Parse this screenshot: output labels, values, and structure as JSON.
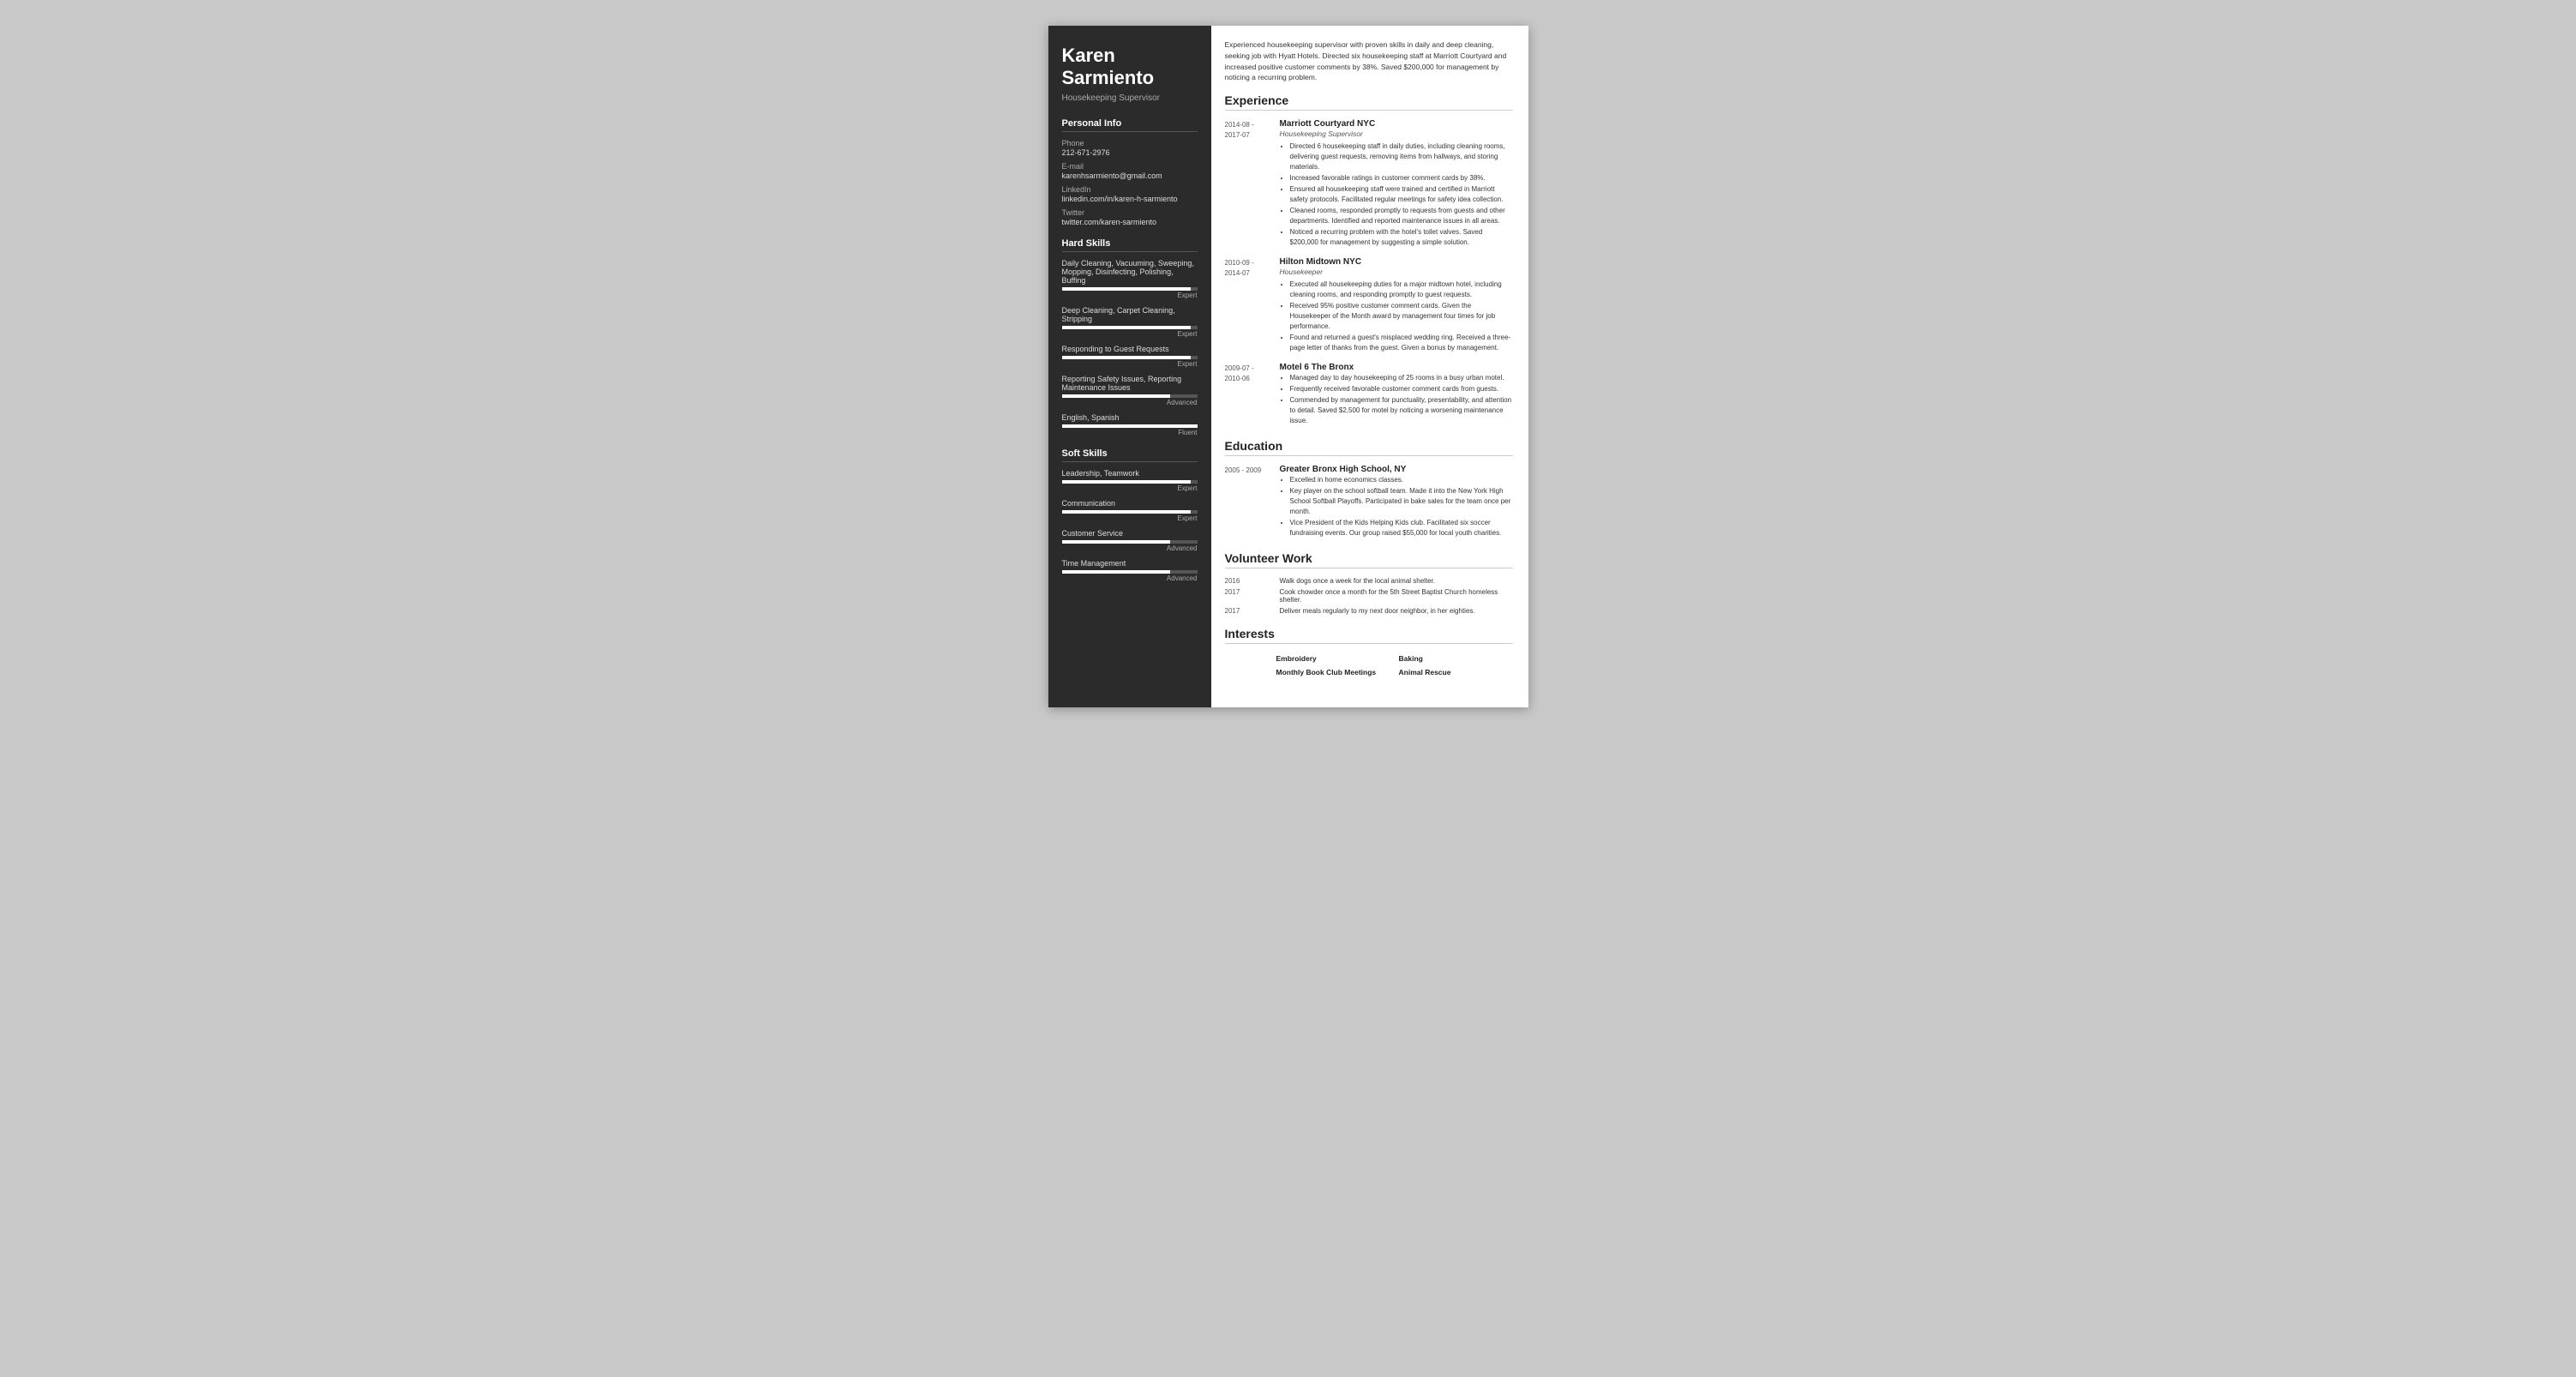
{
  "sidebar": {
    "name_line1": "Karen",
    "name_line2": "Sarmiento",
    "job_title": "Housekeeping Supervisor",
    "personal_info": {
      "section_title": "Personal Info",
      "phone_label": "Phone",
      "phone_value": "212-671-2976",
      "email_label": "E-mail",
      "email_value": "karenhsarmiento@gmail.com",
      "linkedin_label": "LinkedIn",
      "linkedin_value": "linkedin.com/in/karen-h-sarmiento",
      "twitter_label": "Twitter",
      "twitter_value": "twitter.com/karen-sarmiento"
    },
    "hard_skills": {
      "section_title": "Hard Skills",
      "skills": [
        {
          "name": "Daily Cleaning, Vacuuming, Sweeping, Mopping, Disinfecting, Polishing, Buffing",
          "level": "Expert",
          "pct": 95
        },
        {
          "name": "Deep Cleaning, Carpet Cleaning, Stripping",
          "level": "Expert",
          "pct": 95
        },
        {
          "name": "Responding to Guest Requests",
          "level": "Expert",
          "pct": 95
        },
        {
          "name": "Reporting Safety Issues, Reporting Maintenance Issues",
          "level": "Advanced",
          "pct": 80
        },
        {
          "name": "English, Spanish",
          "level": "Fluent",
          "pct": 100
        }
      ]
    },
    "soft_skills": {
      "section_title": "Soft Skills",
      "skills": [
        {
          "name": "Leadership, Teamwork",
          "level": "Expert",
          "pct": 95
        },
        {
          "name": "Communication",
          "level": "Expert",
          "pct": 95
        },
        {
          "name": "Customer Service",
          "level": "Advanced",
          "pct": 80
        },
        {
          "name": "Time Management",
          "level": "Advanced",
          "pct": 80
        }
      ]
    }
  },
  "main": {
    "summary": "Experienced housekeeping supervisor with proven skills in daily and deep cleaning, seeking job with Hyatt Hotels. Directed six housekeeping staff at Marriott Courtyard and increased positive customer comments by 38%. Saved $200,000 for management by noticing a recurring problem.",
    "experience": {
      "section_title": "Experience",
      "entries": [
        {
          "date": "2014-08 - 2017-07",
          "company": "Marriott Courtyard NYC",
          "title": "Housekeeping Supervisor",
          "bullets": [
            "Directed 6 housekeeping staff in daily duties, including cleaning rooms, delivering guest requests, removing items from hallways, and storing materials.",
            "Increased favorable ratings in customer comment cards by 38%.",
            "Ensured all housekeeping staff were trained and certified in Marriott safety protocols. Facilitated regular meetings for safety idea collection.",
            "Cleaned rooms, responded promptly to requests from guests and other departments. Identified and reported maintenance issues in all areas.",
            "Noticed a recurring problem with the hotel's toilet valves. Saved $200,000 for management by suggesting a simple solution."
          ]
        },
        {
          "date": "2010-09 - 2014-07",
          "company": "Hilton Midtown NYC",
          "title": "Housekeeper",
          "bullets": [
            "Executed all housekeeping duties for a major midtown hotel, including cleaning rooms, and responding promptly to guest requests.",
            "Received 95% positive customer comment cards. Given the Housekeeper of the Month award by management four times for job performance.",
            "Found and returned a guest's misplaced wedding ring. Received a three-page letter of thanks from the guest. Given a bonus by management."
          ]
        },
        {
          "date": "2009-07 - 2010-06",
          "company": "Motel 6 The Bronx",
          "title": "",
          "bullets": [
            "Managed day to day housekeeping of 25 rooms in a busy urban motel.",
            "Frequently received favorable customer comment cards from guests.",
            "Commended by management for punctuality, presentability, and attention to detail. Saved $2,500 for motel by noticing a worsening maintenance issue."
          ]
        }
      ]
    },
    "education": {
      "section_title": "Education",
      "entries": [
        {
          "date": "2005 - 2009",
          "school": "Greater Bronx High School, NY",
          "bullets": [
            "Excelled in home economics classes.",
            "Key player on the school softball team. Made it into the New York High School Softball Playoffs. Participated in bake sales for the team once per month.",
            "Vice President of the Kids Helping Kids club. Facilitated six soccer fundraising events. Our group raised $55,000 for local youth charities."
          ]
        }
      ]
    },
    "volunteer": {
      "section_title": "Volunteer Work",
      "entries": [
        {
          "year": "2016",
          "text": "Walk dogs once a week for the local animal shelter."
        },
        {
          "year": "2017",
          "text": "Cook chowder once a month for the 5th Street Baptist Church homeless shelter."
        },
        {
          "year": "2017",
          "text": "Deliver meals regularly to my next door neighbor, in her eighties."
        }
      ]
    },
    "interests": {
      "section_title": "Interests",
      "items": [
        "Embroidery",
        "Baking",
        "Monthly Book Club Meetings",
        "Animal Rescue"
      ]
    }
  }
}
